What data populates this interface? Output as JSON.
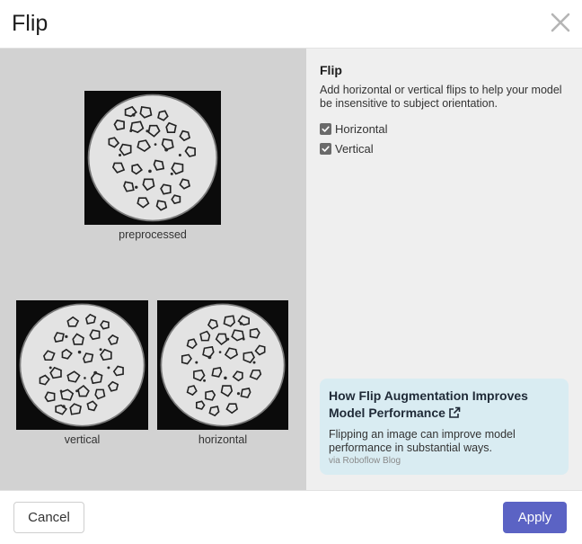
{
  "dialog": {
    "title": "Flip",
    "close_icon": "close-icon"
  },
  "preview": {
    "images": [
      {
        "caption": "preprocessed",
        "transform": "none"
      },
      {
        "caption": "vertical",
        "transform": "flip-vertical"
      },
      {
        "caption": "horizontal",
        "transform": "flip-horizontal"
      }
    ]
  },
  "options": {
    "title": "Flip",
    "description": "Add horizontal or vertical flips to help your model be insensitive to subject orientation.",
    "checkboxes": [
      {
        "label": "Horizontal",
        "checked": true
      },
      {
        "label": "Vertical",
        "checked": true
      }
    ]
  },
  "blog_card": {
    "title": "How Flip Augmentation Improves Model Performance",
    "icon": "external-link-icon",
    "body": "Flipping an image can improve model performance in substantial ways.",
    "source": "via Roboflow Blog"
  },
  "footer": {
    "cancel_label": "Cancel",
    "apply_label": "Apply"
  },
  "colors": {
    "primary": "#5b63c4",
    "preview_bg": "#d2d2d2",
    "panel_bg": "#efefef",
    "card_bg": "#d9ecf2"
  }
}
